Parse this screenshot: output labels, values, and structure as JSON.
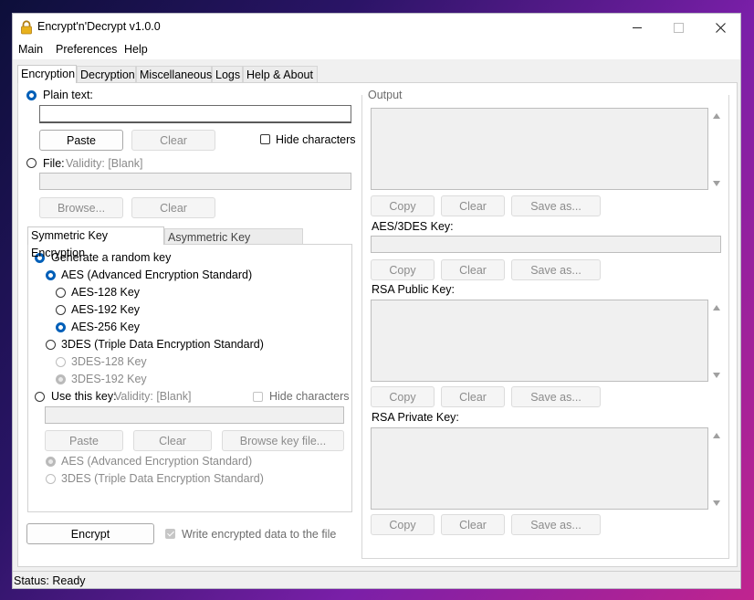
{
  "window": {
    "title": "Encrypt'n'Decrypt v1.0.0"
  },
  "menu": [
    "Main",
    "Preferences",
    "Help"
  ],
  "main_tabs": [
    "Encryption",
    "Decryption",
    "Miscellaneous",
    "Logs",
    "Help & About"
  ],
  "input": {
    "plain_text_label": "Plain text:",
    "plain_text_value": "",
    "paste_label": "Paste",
    "clear_label": "Clear",
    "hide_characters_label": "Hide characters",
    "file_label": "File:",
    "file_validity": "Validity: [Blank]",
    "file_path_value": "",
    "browse_label": "Browse...",
    "clear_file_label": "Clear"
  },
  "key_tabs": [
    "Symmetric Key Encryption",
    "Asymmetric Key Encryption"
  ],
  "symmetric": {
    "generate_label": "Generate a random key",
    "aes_label": "AES (Advanced Encryption Standard)",
    "aes_options": [
      "AES-128 Key",
      "AES-192 Key",
      "AES-256 Key"
    ],
    "aes_selected": "AES-256 Key",
    "des_label": "3DES (Triple Data Encryption Standard)",
    "des_options": [
      "3DES-128 Key",
      "3DES-192 Key"
    ],
    "use_key_label": "Use this key:",
    "key_validity": "Validity: [Blank]",
    "hide_characters_label": "Hide characters",
    "key_value": "",
    "paste_label": "Paste",
    "clear_label": "Clear",
    "browse_key_label": "Browse key file...",
    "algo_aes_label": "AES (Advanced Encryption Standard)",
    "algo_des_label": "3DES (Triple Data Encryption Standard)"
  },
  "actions": {
    "encrypt_label": "Encrypt",
    "write_to_file_label": "Write encrypted data to the file"
  },
  "output": {
    "group_label": "Output",
    "copy_label": "Copy",
    "clear_label": "Clear",
    "save_label": "Save as...",
    "aes_key_label": "AES/3DES Key:",
    "rsa_public_label": "RSA Public Key:",
    "rsa_private_label": "RSA Private Key:",
    "output_value": "",
    "aes_key_value": "",
    "rsa_public_value": "",
    "rsa_private_value": ""
  },
  "status": {
    "text": "Status: Ready"
  },
  "colors": {
    "accent": "#005fb8",
    "lock_icon": "#e8b11c"
  }
}
